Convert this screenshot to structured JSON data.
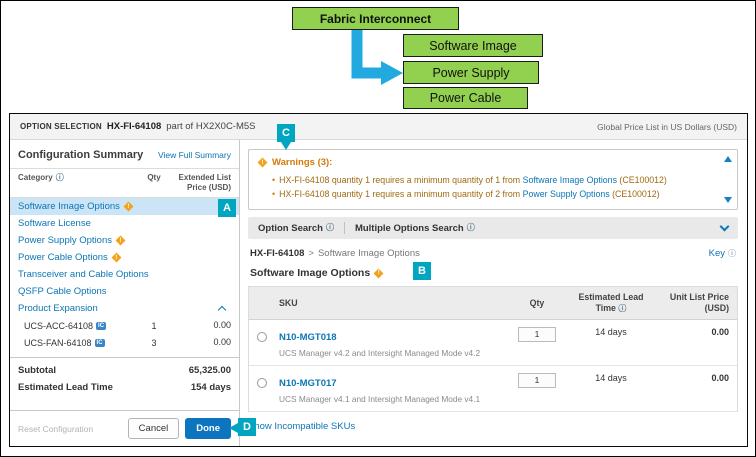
{
  "annotations": {
    "boxes": [
      {
        "label": "Fabric Interconnect"
      },
      {
        "label": "Software Image"
      },
      {
        "label": "Power Supply"
      },
      {
        "label": "Power Cable"
      }
    ],
    "callouts": {
      "a": "A",
      "b": "B",
      "c": "C",
      "d": "D"
    },
    "colors": {
      "green": "#92D050",
      "teal": "#00A5C0",
      "arrow": "#22A9E0"
    }
  },
  "icons": {
    "info_mark": "ⓘ",
    "warning_mark": "!",
    "bullet": "•"
  },
  "header": {
    "section_label": "OPTION SELECTION",
    "product": "HX-FI-64108",
    "part_of": "part of HX2X0C-M5S",
    "price_list": "Global Price List in US Dollars (USD)"
  },
  "summary": {
    "title": "Configuration Summary",
    "view_full": "View Full Summary",
    "columns": {
      "category": "Category",
      "qty": "Qty",
      "price_line1": "Extended List",
      "price_line2": "Price (USD)"
    },
    "categories": [
      {
        "label": "Software Image Options"
      },
      {
        "label": "Software License"
      },
      {
        "label": "Power Supply Options"
      },
      {
        "label": "Power Cable Options"
      },
      {
        "label": "Transceiver and Cable Options"
      },
      {
        "label": "QSFP Cable Options"
      },
      {
        "label": "Product Expansion"
      }
    ],
    "products": [
      {
        "name": "UCS-ACC-64108",
        "badge": "IC",
        "qty": "1",
        "price": "0.00"
      },
      {
        "name": "UCS-FAN-64108",
        "badge": "IC",
        "qty": "3",
        "price": "0.00"
      }
    ],
    "subtotal_label": "Subtotal",
    "subtotal_value": "65,325.00",
    "lead_time_label": "Estimated Lead Time",
    "lead_time_value": "154 days",
    "reset_label": "Reset Configuration",
    "cancel_label": "Cancel",
    "done_label": "Done"
  },
  "warnings": {
    "title": "Warnings (3):",
    "items": [
      {
        "pre": "HX-FI-64108 quantity 1 requires a minimum quantity of 1 from",
        "link": "Software Image Options",
        "code": "(CE100012)"
      },
      {
        "pre": "HX-FI-64108 quantity 1 requires a minimum quantity of 2 from",
        "link": "Power Supply Options",
        "code": "(CE100012)"
      }
    ]
  },
  "search_bar": {
    "option_search": "Option Search",
    "multiple_options": "Multiple Options Search"
  },
  "breadcrumb": {
    "parent": "HX-FI-64108",
    "sep": ">",
    "current": "Software Image Options",
    "key_label": "Key"
  },
  "options_section": {
    "title": "Software Image Options",
    "table": {
      "headers": {
        "sku": "SKU",
        "qty": "Qty",
        "lead1": "Estimated Lead",
        "lead2": "Time",
        "price1": "Unit List Price",
        "price2": "(USD)"
      },
      "rows": [
        {
          "sku": "N10-MGT018",
          "desc": "UCS Manager v4.2 and Intersight Managed Mode v4.2",
          "qty": "1",
          "lead": "14 days",
          "price": "0.00"
        },
        {
          "sku": "N10-MGT017",
          "desc": "UCS Manager v4.1 and Intersight Managed Mode v4.1",
          "qty": "1",
          "lead": "14 days",
          "price": "0.00"
        }
      ]
    },
    "show_incompatible": "Show Incompatible SKUs"
  }
}
